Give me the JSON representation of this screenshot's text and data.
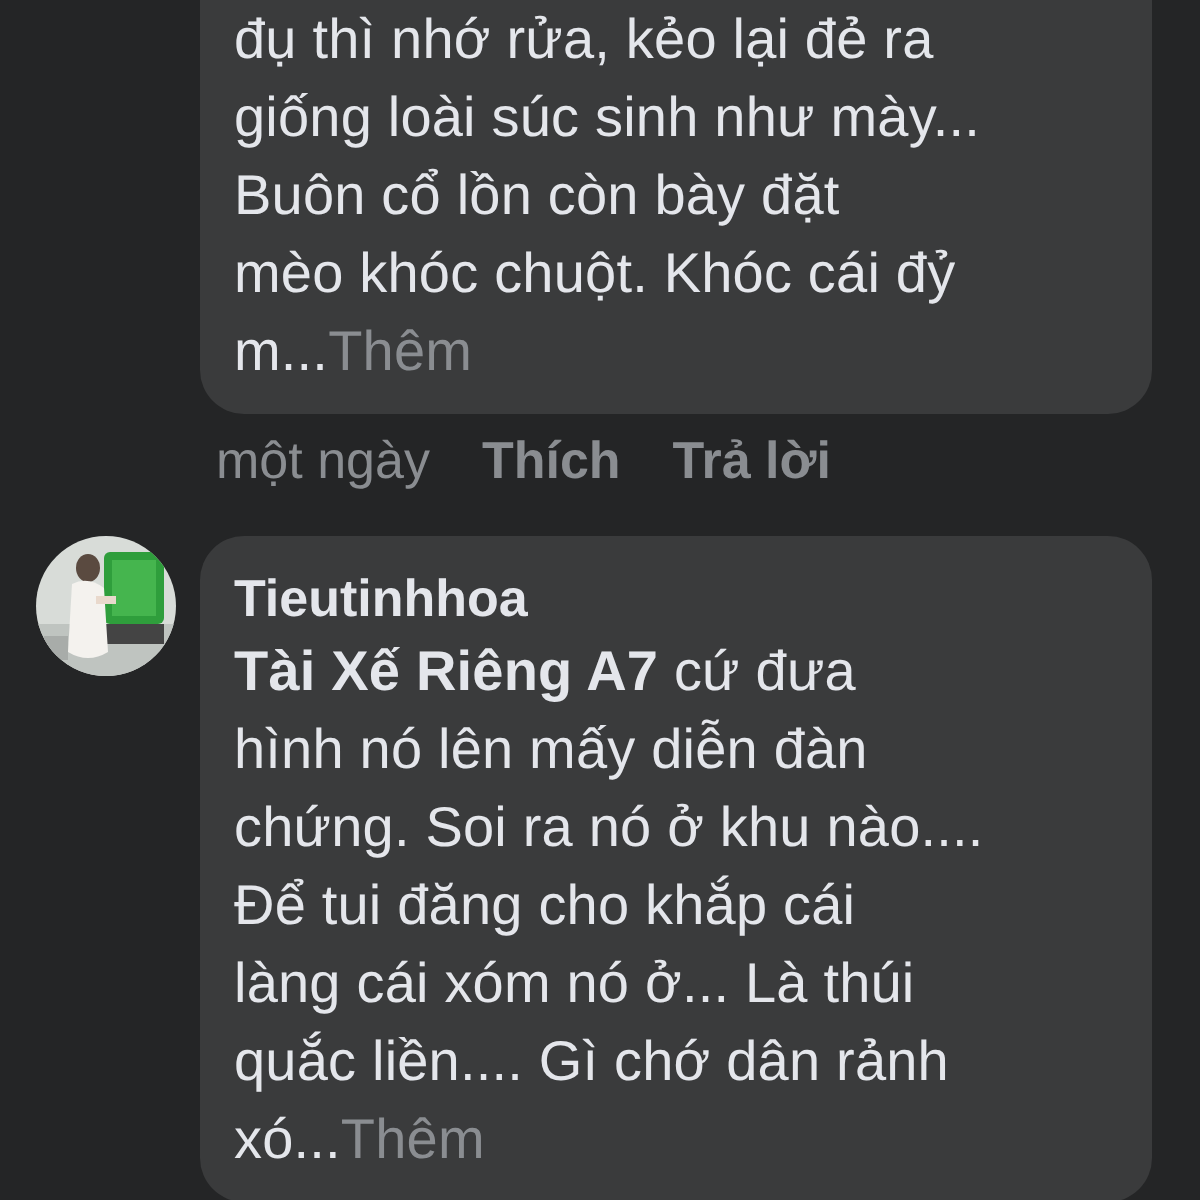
{
  "comments": [
    {
      "text": "đụ thì nhớ rửa, kẻo lại đẻ ra\ngiống loài súc sinh như mày...\nBuôn cổ lồn còn bày đặt\nmèo khóc chuột. Khóc cái đỷ\nm...",
      "more": "Thêm",
      "time": "một ngày",
      "actions": [
        "Thích",
        "Trả lời"
      ]
    },
    {
      "author": "Tieutinhhoa",
      "text": "**Tài Xế Riêng A7**  cứ đưa\nhình nó lên mấy diễn đàn\nchứng. Soi ra nó ở khu nào....\nĐể tui đăng cho khắp cái\nlàng cái xóm nó ở... Là thúi\nquắc liền.... Gì chớ dân rảnh\nxó...",
      "more": "Thêm"
    }
  ]
}
